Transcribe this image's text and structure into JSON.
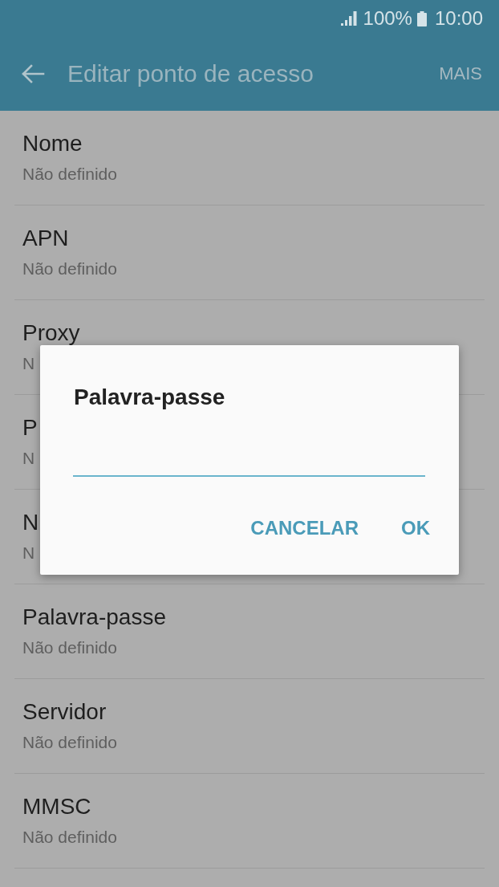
{
  "status_bar": {
    "battery": "100%",
    "time": "10:00"
  },
  "app_bar": {
    "title": "Editar ponto de acesso",
    "action": "MAIS"
  },
  "settings": [
    {
      "title": "Nome",
      "value": "Não definido"
    },
    {
      "title": "APN",
      "value": "Não definido"
    },
    {
      "title": "Proxy",
      "value": "N"
    },
    {
      "title": "P",
      "value": "N"
    },
    {
      "title": "N",
      "value": "N"
    },
    {
      "title": "Palavra-passe",
      "value": "Não definido"
    },
    {
      "title": "Servidor",
      "value": "Não definido"
    },
    {
      "title": "MMSC",
      "value": "Não definido"
    }
  ],
  "dialog": {
    "title": "Palavra-passe",
    "field": {
      "focused": true
    },
    "buttons": [
      "CANCELAR",
      "OK"
    ]
  }
}
